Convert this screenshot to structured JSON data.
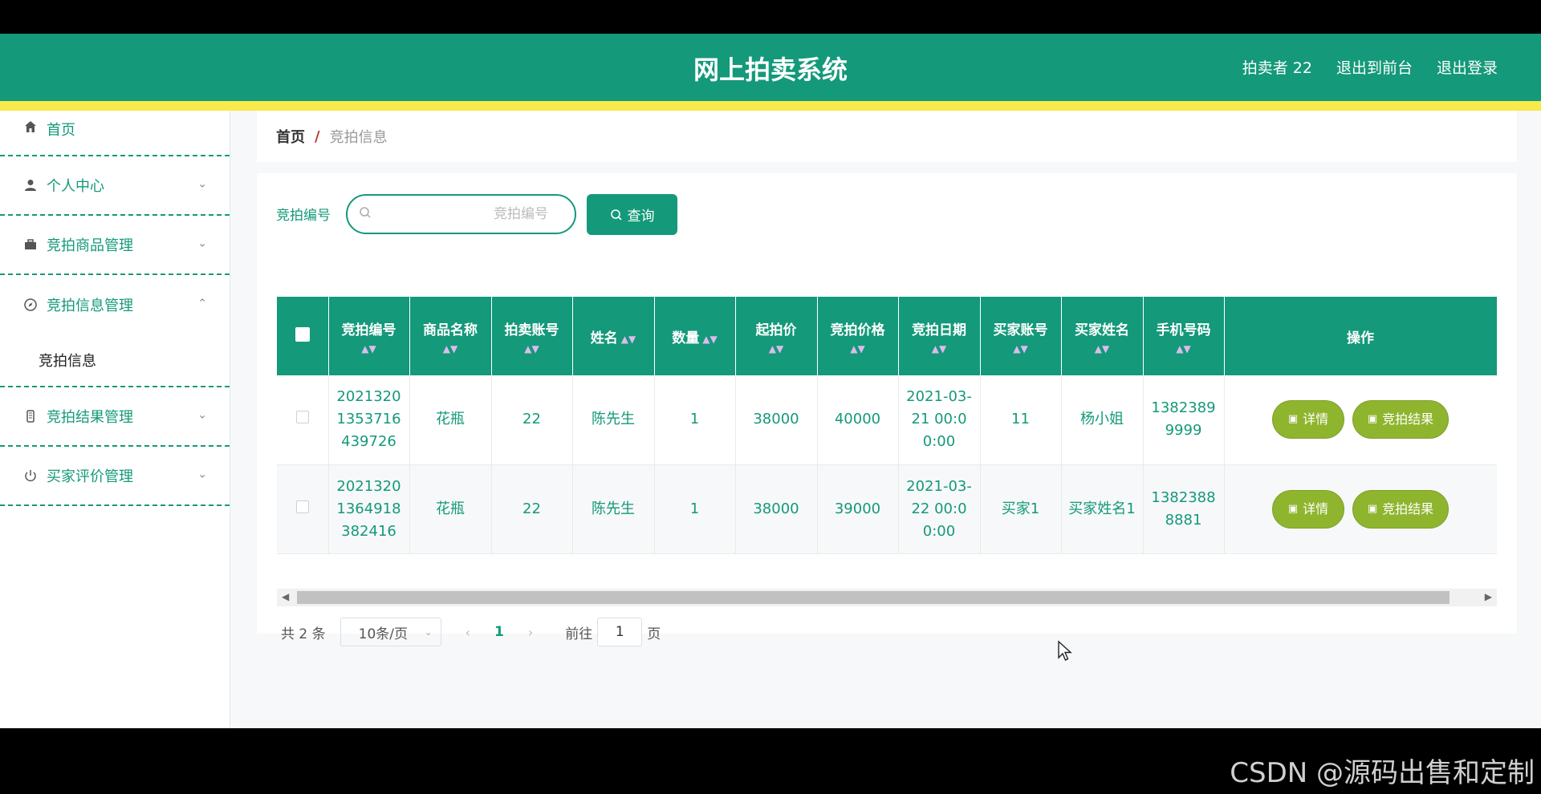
{
  "header": {
    "title": "网上拍卖系统",
    "user": "拍卖者 22",
    "exit_front": "退出到前台",
    "logout": "退出登录",
    "brand_color": "#14997a",
    "stripe_color": "#f7ea4a"
  },
  "sidebar": {
    "items": [
      {
        "label": "首页",
        "icon": "home-icon"
      },
      {
        "label": "个人中心",
        "icon": "user-icon"
      },
      {
        "label": "竞拍商品管理",
        "icon": "briefcase-icon"
      },
      {
        "label": "竞拍信息管理",
        "icon": "compass-icon",
        "expanded": true,
        "children": [
          {
            "label": "竞拍信息"
          }
        ]
      },
      {
        "label": "竞拍结果管理",
        "icon": "phone-icon"
      },
      {
        "label": "买家评价管理",
        "icon": "power-icon"
      }
    ]
  },
  "breadcrumb": {
    "home": "首页",
    "sep": "/",
    "current": "竞拍信息"
  },
  "search": {
    "label": "竞拍编号",
    "placeholder": "竞拍编号",
    "value": "",
    "button": "查询"
  },
  "table": {
    "columns": [
      "竞拍编号",
      "商品名称",
      "拍卖账号",
      "姓名",
      "数量",
      "起拍价",
      "竞拍价格",
      "竞拍日期",
      "买家账号",
      "买家姓名",
      "手机号码",
      "操作"
    ],
    "rows": [
      {
        "id": "20213201353716439726",
        "name": "花瓶",
        "account": "22",
        "seller": "陈先生",
        "qty": "1",
        "start_price": "38000",
        "bid_price": "40000",
        "date": "2021-03-21 00:00:00",
        "buyer_account": "11",
        "buyer_name": "杨小姐",
        "phone": "13823899999"
      },
      {
        "id": "20213201364918382416",
        "name": "花瓶",
        "account": "22",
        "seller": "陈先生",
        "qty": "1",
        "start_price": "38000",
        "bid_price": "39000",
        "date": "2021-03-22 00:00:00",
        "buyer_account": "买家1",
        "buyer_name": "买家姓名1",
        "phone": "13823888881"
      }
    ],
    "actions": {
      "detail": "详情",
      "result": "竞拍结果"
    },
    "action_color": "#8fb52e"
  },
  "pager": {
    "total": "共 2 条",
    "size": "10条/页",
    "page": "1",
    "goto_label": "前往",
    "goto_value": "1",
    "page_suffix": "页"
  },
  "watermark": "CSDN @源码出售和定制"
}
